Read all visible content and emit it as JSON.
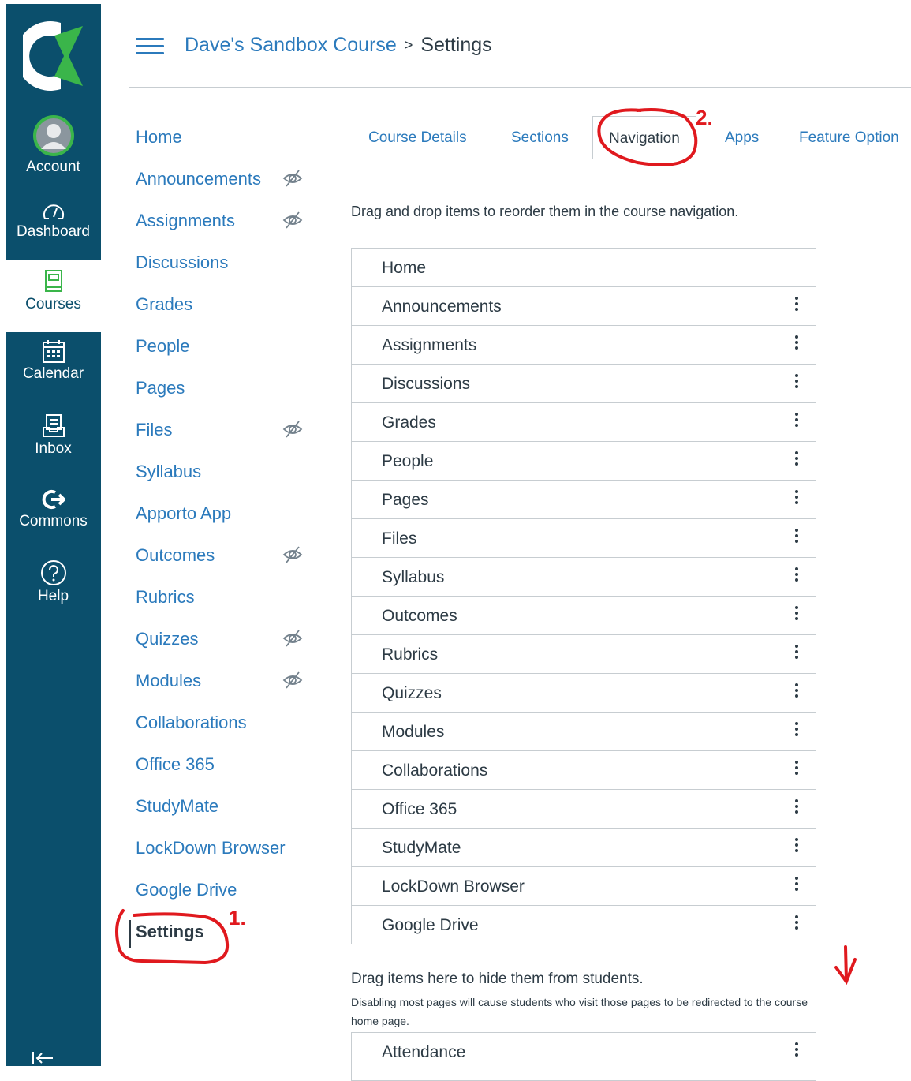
{
  "global_nav": {
    "account": "Account",
    "dashboard": "Dashboard",
    "courses": "Courses",
    "calendar": "Calendar",
    "inbox": "Inbox",
    "commons": "Commons",
    "help": "Help",
    "accent": "#0b4f6c"
  },
  "breadcrumb": {
    "course": "Dave's Sandbox Course",
    "separator": ">",
    "current": "Settings"
  },
  "course_nav": {
    "items": [
      {
        "label": "Home",
        "hidden": false
      },
      {
        "label": "Announcements",
        "hidden": true
      },
      {
        "label": "Assignments",
        "hidden": true
      },
      {
        "label": "Discussions",
        "hidden": false
      },
      {
        "label": "Grades",
        "hidden": false
      },
      {
        "label": "People",
        "hidden": false
      },
      {
        "label": "Pages",
        "hidden": false
      },
      {
        "label": "Files",
        "hidden": true
      },
      {
        "label": "Syllabus",
        "hidden": false
      },
      {
        "label": "Apporto App",
        "hidden": false
      },
      {
        "label": "Outcomes",
        "hidden": true
      },
      {
        "label": "Rubrics",
        "hidden": false
      },
      {
        "label": "Quizzes",
        "hidden": true
      },
      {
        "label": "Modules",
        "hidden": true
      },
      {
        "label": "Collaborations",
        "hidden": false
      },
      {
        "label": "Office 365",
        "hidden": false
      },
      {
        "label": "StudyMate",
        "hidden": false
      },
      {
        "label": "LockDown Browser",
        "hidden": false
      },
      {
        "label": "Google Drive",
        "hidden": false
      },
      {
        "label": "Settings",
        "hidden": false,
        "active": true
      }
    ]
  },
  "tabs": {
    "course_details": "Course Details",
    "sections": "Sections",
    "navigation": "Navigation",
    "apps": "Apps",
    "feature_options": "Feature Option"
  },
  "instructions": "Drag and drop items to reorder them in the course navigation.",
  "nav_list": [
    "Home",
    "Announcements",
    "Assignments",
    "Discussions",
    "Grades",
    "People",
    "Pages",
    "Files",
    "Syllabus",
    "Outcomes",
    "Rubrics",
    "Quizzes",
    "Modules",
    "Collaborations",
    "Office 365",
    "StudyMate",
    "LockDown Browser",
    "Google Drive"
  ],
  "hidden_section": {
    "title": "Drag items here to hide them from students.",
    "note": "Disabling most pages will cause students who visit those pages to be redirected to the course home page.",
    "items": [
      "Attendance"
    ]
  },
  "annotations": {
    "settings_mark": "1.",
    "navigation_mark": "2.",
    "color": "#e0191e"
  }
}
